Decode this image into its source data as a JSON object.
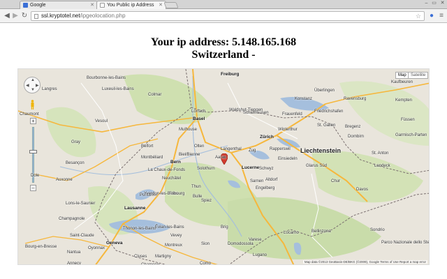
{
  "browser": {
    "tabs": [
      {
        "label": "Google",
        "active": false,
        "favicon_color": "#3b6fd6"
      },
      {
        "label": "You Public ip Address",
        "active": true,
        "favicon_color": "#ffffff"
      }
    ],
    "url_host": "ssl.kryptotel.net",
    "url_path": "/ipgeolocation.php",
    "icons": [
      "back-icon",
      "forward-icon",
      "reload-icon",
      "page-icon",
      "star-icon",
      "menu-icon"
    ]
  },
  "page": {
    "ip_line": "Your ip address: 5.148.165.168",
    "country_line": "Switzerland -"
  },
  "map": {
    "map_type_buttons": [
      "Map",
      "Satellite"
    ],
    "labels": [
      {
        "t": "Freiburg",
        "c": "city"
      },
      {
        "t": "Basel",
        "c": "city"
      },
      {
        "t": "Mulhouse",
        "c": ""
      },
      {
        "t": "Colmar",
        "c": ""
      },
      {
        "t": "Belfort",
        "c": ""
      },
      {
        "t": "Montbéliard",
        "c": ""
      },
      {
        "t": "Besançon",
        "c": ""
      },
      {
        "t": "Dole",
        "c": ""
      },
      {
        "t": "Vesoul",
        "c": ""
      },
      {
        "t": "Luxeuil-les-Bains",
        "c": ""
      },
      {
        "t": "Bourbonne-les-Bains",
        "c": ""
      },
      {
        "t": "Langres",
        "c": ""
      },
      {
        "t": "Chaumont",
        "c": ""
      },
      {
        "t": "Gray",
        "c": ""
      },
      {
        "t": "Auxonne",
        "c": ""
      },
      {
        "t": "Pontarlier",
        "c": ""
      },
      {
        "t": "Lons-le-Saunier",
        "c": ""
      },
      {
        "t": "Champagnole",
        "c": ""
      },
      {
        "t": "Saint-Claude",
        "c": ""
      },
      {
        "t": "Oyonnax",
        "c": ""
      },
      {
        "t": "Bourg-en-Bresse",
        "c": ""
      },
      {
        "t": "Nantua",
        "c": ""
      },
      {
        "t": "Geneva",
        "c": "city"
      },
      {
        "t": "Annecy",
        "c": ""
      },
      {
        "t": "Thonon-les-Bains",
        "c": ""
      },
      {
        "t": "Évian-les-Bains",
        "c": ""
      },
      {
        "t": "Cluses",
        "c": ""
      },
      {
        "t": "Lausanne",
        "c": "city"
      },
      {
        "t": "Yverdon-les-Bains",
        "c": ""
      },
      {
        "t": "Neuchâtel",
        "c": ""
      },
      {
        "t": "La Chaux-de-Fonds",
        "c": ""
      },
      {
        "t": "Biel/Bienne",
        "c": ""
      },
      {
        "t": "Solothurn",
        "c": ""
      },
      {
        "t": "Bern",
        "c": "city"
      },
      {
        "t": "Fribourg",
        "c": ""
      },
      {
        "t": "Bulle",
        "c": ""
      },
      {
        "t": "Thun",
        "c": ""
      },
      {
        "t": "Spiez",
        "c": ""
      },
      {
        "t": "Montreux",
        "c": ""
      },
      {
        "t": "Vevey",
        "c": ""
      },
      {
        "t": "Martigny",
        "c": ""
      },
      {
        "t": "Sion",
        "c": ""
      },
      {
        "t": "Brig",
        "c": ""
      },
      {
        "t": "Chamonix",
        "c": ""
      },
      {
        "t": "Olten",
        "c": ""
      },
      {
        "t": "Aarau",
        "c": ""
      },
      {
        "t": "Langenthal",
        "c": ""
      },
      {
        "t": "Lucerne",
        "c": "city"
      },
      {
        "t": "Zug",
        "c": ""
      },
      {
        "t": "Schwyz",
        "c": ""
      },
      {
        "t": "Altdorf",
        "c": ""
      },
      {
        "t": "Sarnen",
        "c": ""
      },
      {
        "t": "Engelberg",
        "c": ""
      },
      {
        "t": "Zürich",
        "c": "city"
      },
      {
        "t": "Winterthur",
        "c": ""
      },
      {
        "t": "Frauenfeld",
        "c": ""
      },
      {
        "t": "Konstanz",
        "c": ""
      },
      {
        "t": "Schaffhausen",
        "c": ""
      },
      {
        "t": "Waldshut-Tiengen",
        "c": ""
      },
      {
        "t": "Lörrach",
        "c": ""
      },
      {
        "t": "Friedrichshafen",
        "c": ""
      },
      {
        "t": "Ravensburg",
        "c": ""
      },
      {
        "t": "Überlingen",
        "c": ""
      },
      {
        "t": "Kaufbeuren",
        "c": ""
      },
      {
        "t": "Kempten",
        "c": ""
      },
      {
        "t": "Füssen",
        "c": ""
      },
      {
        "t": "Garmisch-Parten",
        "c": ""
      },
      {
        "t": "Dornbirn",
        "c": ""
      },
      {
        "t": "Bregenz",
        "c": ""
      },
      {
        "t": "St. Gallen",
        "c": ""
      },
      {
        "t": "Liechtenstein",
        "c": "big"
      },
      {
        "t": "St. Anton",
        "c": ""
      },
      {
        "t": "Landeck",
        "c": ""
      },
      {
        "t": "Chur",
        "c": ""
      },
      {
        "t": "Davos",
        "c": ""
      },
      {
        "t": "Glarus Süd",
        "c": ""
      },
      {
        "t": "Rapperswil",
        "c": ""
      },
      {
        "t": "Einsiedeln",
        "c": ""
      },
      {
        "t": "Bellinzona",
        "c": ""
      },
      {
        "t": "Locarno",
        "c": ""
      },
      {
        "t": "Lugano",
        "c": ""
      },
      {
        "t": "Varese",
        "c": ""
      },
      {
        "t": "Como",
        "c": ""
      },
      {
        "t": "Domodossola",
        "c": ""
      },
      {
        "t": "Sondrio",
        "c": ""
      },
      {
        "t": "Parco Nazionale dello Stelvio",
        "c": ""
      }
    ],
    "attribution": "Map data ©2013 GeoBasis-DE/BKG (©2009), Google   Terms of Use   Report a map error",
    "colors": {
      "land": "#e9e5dc",
      "forest": "#cfe0b0",
      "water": "#a5bfdd",
      "highway": "#f6b73c",
      "border": "#7a6f6f",
      "marker": "#d33a2c"
    }
  }
}
